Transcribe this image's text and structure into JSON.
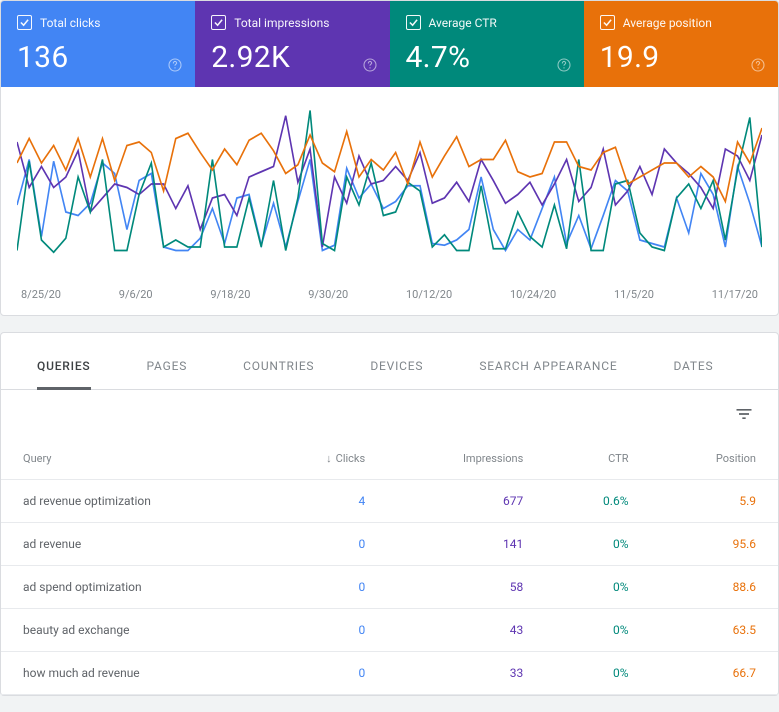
{
  "colors": {
    "clicks": "#4285f4",
    "impressions": "#5e35b1",
    "ctr": "#00897b",
    "position": "#e8710a"
  },
  "cards": {
    "clicks": {
      "label": "Total clicks",
      "value": "136"
    },
    "impressions": {
      "label": "Total impressions",
      "value": "2.92K"
    },
    "ctr": {
      "label": "Average CTR",
      "value": "4.7%"
    },
    "position": {
      "label": "Average position",
      "value": "19.9"
    }
  },
  "chart_data": {
    "type": "line",
    "x_ticks": [
      "8/25/20",
      "9/6/20",
      "9/18/20",
      "9/30/20",
      "10/12/20",
      "10/24/20",
      "11/5/20",
      "11/17/20"
    ],
    "series": [
      {
        "name": "clicks",
        "color": "#4285f4",
        "values": [
          44,
          70,
          26,
          69,
          40,
          38,
          45,
          68,
          62,
          30,
          58,
          62,
          20,
          18,
          18,
          25,
          42,
          22,
          48,
          50,
          21,
          45,
          20,
          46,
          70,
          18,
          21,
          65,
          48,
          56,
          42,
          46,
          55,
          55,
          22,
          21,
          24,
          30,
          60,
          30,
          18,
          30,
          24,
          42,
          60,
          22,
          38,
          19,
          38,
          58,
          52,
          24,
          22,
          20,
          48,
          28,
          62,
          50,
          20,
          66,
          45,
          20
        ]
      },
      {
        "name": "impressions",
        "color": "#5e35b1",
        "values": [
          80,
          54,
          66,
          54,
          60,
          75,
          40,
          48,
          56,
          54,
          50,
          56,
          56,
          42,
          55,
          30,
          48,
          50,
          38,
          60,
          63,
          66,
          95,
          57,
          76,
          20,
          60,
          45,
          72,
          56,
          58,
          66,
          58,
          74,
          45,
          48,
          57,
          46,
          70,
          58,
          45,
          50,
          57,
          44,
          56,
          70,
          46,
          54,
          76,
          44,
          52,
          66,
          50,
          76,
          68,
          62,
          54,
          42,
          76,
          72,
          58,
          84
        ]
      },
      {
        "name": "ctr",
        "color": "#00897b",
        "values": [
          18,
          69,
          24,
          17,
          25,
          60,
          40,
          70,
          18,
          18,
          50,
          68,
          20,
          24,
          20,
          20,
          70,
          20,
          20,
          48,
          20,
          58,
          18,
          48,
          98,
          22,
          18,
          60,
          44,
          68,
          38,
          40,
          57,
          52,
          20,
          27,
          18,
          18,
          55,
          19,
          19,
          40,
          26,
          20,
          44,
          19,
          70,
          18,
          18,
          56,
          58,
          28,
          20,
          18,
          48,
          56,
          42,
          58,
          24,
          64,
          94,
          20
        ]
      },
      {
        "name": "position",
        "color": "#e8710a",
        "values": [
          68,
          82,
          68,
          78,
          64,
          82,
          60,
          82,
          58,
          78,
          80,
          74,
          52,
          82,
          85,
          74,
          64,
          76,
          67,
          81,
          85,
          75,
          62,
          67,
          84,
          68,
          63,
          86,
          60,
          70,
          64,
          74,
          56,
          80,
          60,
          72,
          83,
          66,
          70,
          70,
          81,
          63,
          60,
          62,
          80,
          80,
          66,
          64,
          74,
          77,
          56,
          60,
          64,
          68,
          68,
          60,
          66,
          60,
          46,
          80,
          68,
          88
        ]
      }
    ]
  },
  "tabs": [
    {
      "id": "queries",
      "label": "QUERIES",
      "active": true
    },
    {
      "id": "pages",
      "label": "PAGES"
    },
    {
      "id": "countries",
      "label": "COUNTRIES"
    },
    {
      "id": "devices",
      "label": "DEVICES"
    },
    {
      "id": "search-appearance",
      "label": "SEARCH APPEARANCE"
    },
    {
      "id": "dates",
      "label": "DATES"
    }
  ],
  "table": {
    "headers": {
      "query": "Query",
      "clicks": "Clicks",
      "impressions": "Impressions",
      "ctr": "CTR",
      "position": "Position"
    },
    "sort_indicator": "↓",
    "rows": [
      {
        "query": "ad revenue optimization",
        "clicks": "4",
        "impressions": "677",
        "ctr": "0.6%",
        "position": "5.9"
      },
      {
        "query": "ad revenue",
        "clicks": "0",
        "impressions": "141",
        "ctr": "0%",
        "position": "95.6"
      },
      {
        "query": "ad spend optimization",
        "clicks": "0",
        "impressions": "58",
        "ctr": "0%",
        "position": "88.6"
      },
      {
        "query": "beauty ad exchange",
        "clicks": "0",
        "impressions": "43",
        "ctr": "0%",
        "position": "63.5"
      },
      {
        "query": "how much ad revenue",
        "clicks": "0",
        "impressions": "33",
        "ctr": "0%",
        "position": "66.7"
      }
    ]
  }
}
